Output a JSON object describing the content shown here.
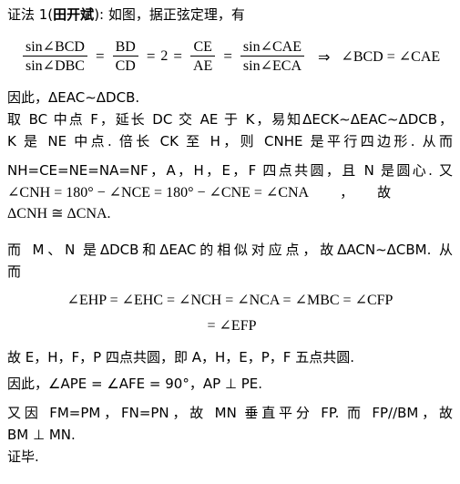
{
  "document": {
    "type": "math-proof",
    "language": "zh-CN",
    "background_color": "#ffffff",
    "text_color": "#000000"
  },
  "heading": {
    "prefix": "证法 1(",
    "author": "田开斌",
    "suffix": "): 如图，据正弦定理，有"
  },
  "equation_sine": {
    "frac1_num": "sin∠BCD",
    "frac1_den": "sin∠DBC",
    "eq1": "=",
    "frac2_num": "BD",
    "frac2_den": "CD",
    "eq2": "=",
    "value": "2",
    "eq3": "=",
    "frac3_num": "CE",
    "frac3_den": "AE",
    "eq4": "=",
    "frac4_num": "sin∠CAE",
    "frac4_den": "sin∠ECA",
    "arrow": "⇒",
    "conclusion": "∠BCD = ∠CAE"
  },
  "body": {
    "line_therefore": "因此，ΔEAC∼ΔDCB.",
    "line_take_1": "取 BC 中点 F，延长 DC 交 AE 于 K，易知ΔECK∼ΔEAC∼ΔDCB，",
    "line_take_2": "K 是 NE 中点. 倍长 CK 至 H，则 CNHE 是平行四边形. 从而",
    "line_equal": "NH=CE=NE=NA=NF，A，H，E，F 四点共圆，且 N 是圆心. 又",
    "line_angle_cnh_a": "∠CNH = 180° − ∠NCE = 180° − ∠CNE = ∠CNA",
    "line_angle_cnh_comma": "，",
    "line_angle_cnh_b": "故",
    "line_congruent": "ΔCNH ≅ ΔCNA.",
    "line_mn_1": "而 M、N 是ΔDCB和ΔEAC的相似对应点，故ΔACN∼ΔCBM. 从",
    "line_mn_2": "而"
  },
  "equation_angles": {
    "row1": "∠EHP = ∠EHC = ∠NCH = ∠NCA = ∠MBC = ∠CFP",
    "row2": "= ∠EFP"
  },
  "conclusion": {
    "line_concyclic": "故 E，H，F，P 四点共圆，即 A，H，E，P，F 五点共圆.",
    "line_perp": "因此，∠APE = ∠AFE = 90°，AP ⊥ PE.",
    "line_bisect_1": "又因 FM=PM，FN=PN，故 MN 垂直平分 FP. 而 FP//BM，故",
    "line_bisect_2": "BM ⊥ MN.",
    "line_qed": "证毕."
  }
}
